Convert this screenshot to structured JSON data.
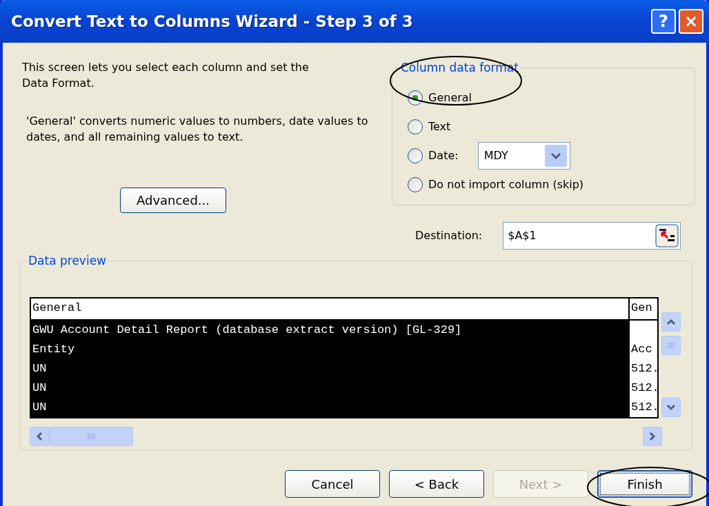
{
  "window": {
    "title": "Convert Text to Columns Wizard - Step 3 of 3",
    "title_buttons": [
      "?",
      "×"
    ]
  },
  "intro": "This screen lets you select each column and set the Data Format.",
  "description": "'General' converts numeric values to numbers, date values to dates, and all remaining values to text.",
  "advanced_button": "Advanced...",
  "column_data_format": {
    "legend": "Column data format",
    "options": [
      {
        "label": "General",
        "selected": true
      },
      {
        "label": "Text",
        "selected": false
      },
      {
        "label": "Date:",
        "selected": false,
        "dropdown": "MDY"
      },
      {
        "label": "Do not import column (skip)",
        "selected": false
      }
    ]
  },
  "destination": {
    "label": "Destination:",
    "value": "$A$1"
  },
  "data_preview": {
    "legend": "Data preview",
    "columns": [
      {
        "header": "General",
        "selected": true
      },
      {
        "header": "Gen",
        "selected": false
      }
    ],
    "rows": [
      [
        "GWU Account Detail Report (database extract version) [GL-329]",
        null
      ],
      [
        "Entity",
        "Acc"
      ],
      [
        "UN",
        "512."
      ],
      [
        "UN",
        "512."
      ],
      [
        "UN",
        "512."
      ]
    ]
  },
  "buttons": [
    {
      "label": "Cancel",
      "disabled": false,
      "default": false
    },
    {
      "label": "< Back",
      "disabled": false,
      "default": false
    },
    {
      "label": "Next >",
      "disabled": true,
      "default": false
    },
    {
      "label": "Finish",
      "disabled": false,
      "default": true
    }
  ],
  "annotations": [
    {
      "kind": "oval"
    },
    {
      "kind": "oval"
    }
  ]
}
